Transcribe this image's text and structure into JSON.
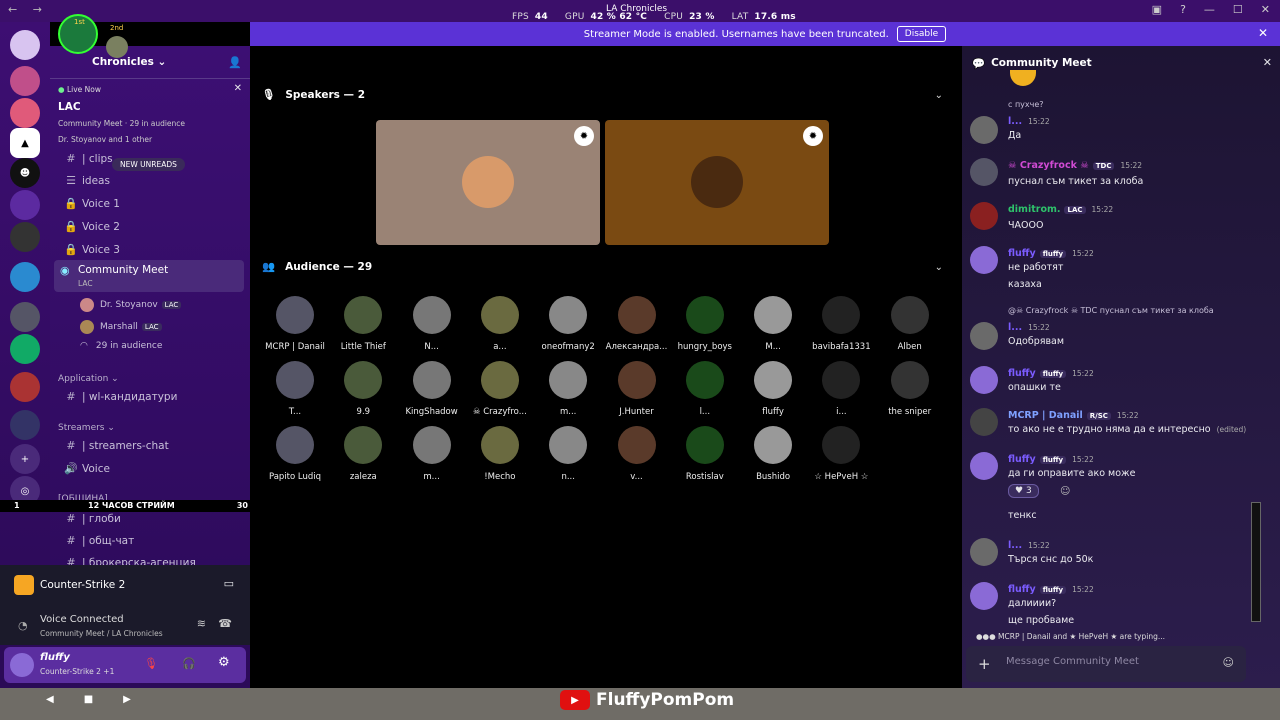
{
  "topbar": {
    "fps_label": "FPS",
    "fps": "44",
    "gpu_label": "GPU",
    "gpu": "42 % 62 °C",
    "cpu_label": "CPU",
    "cpu": "23 %",
    "lat_label": "LAT",
    "lat": "17.6 ms",
    "title": "LA Chronicles"
  },
  "banner": {
    "text": "Streamer Mode is enabled. Usernames have been truncated.",
    "button": "Disable"
  },
  "ranks": {
    "first": "1st",
    "second": "2nd"
  },
  "server": {
    "name": "Chronicles"
  },
  "live": {
    "status": "Live Now",
    "server": "LAC",
    "meta": "Community Meet",
    "audience": "29 in audience",
    "hosts": "Dr. Stoyanov and 1 other"
  },
  "new_unreads": "NEW UNREADS",
  "channels": [
    {
      "name": "| clips",
      "icon": "#"
    },
    {
      "name": "ideas",
      "icon": "📦"
    },
    {
      "name": "Voice 1",
      "icon": "🔊"
    },
    {
      "name": "Voice 2",
      "icon": "🔊"
    },
    {
      "name": "Voice 3",
      "icon": "🔊"
    }
  ],
  "stage_channel": {
    "name": "Community Meet",
    "sub": "LAC",
    "members": [
      {
        "name": "Dr. Stoyanov",
        "tag": "LAC"
      },
      {
        "name": "Marshall",
        "tag": "LAC"
      }
    ],
    "audience": "29 in audience"
  },
  "categories": {
    "application": "Application",
    "streamers": "Streamers",
    "community": "[ОБЩИНА]"
  },
  "app_channels": [
    {
      "name": "| wl-кандидатури"
    }
  ],
  "streamer_channels": [
    {
      "name": "| streamers-chat"
    },
    {
      "name": "Voice"
    }
  ],
  "community_channels": [
    {
      "name": "| глоби"
    },
    {
      "name": "| общ-чат"
    },
    {
      "name": "| брокерска-агенция"
    }
  ],
  "strip": {
    "left": "1",
    "center": "12 ЧАСОВ СТРИЙМ",
    "right": "30"
  },
  "activity": {
    "game": "Counter-Strike 2"
  },
  "voice": {
    "status": "Voice Connected",
    "channel": "Community Meet / LA Chronicles"
  },
  "user": {
    "name": "fluffy",
    "status": "Counter-Strike 2 +1"
  },
  "stage": {
    "speakers_label": "Speakers — 2",
    "audience_label": "Audience — 29"
  },
  "audience": [
    "MCRP | Danail",
    "Little Thief",
    "N...",
    "a...",
    "oneofmany2",
    "Александра...",
    "hungry_boys",
    "M...",
    "bavibafa1331",
    "Alben",
    "T...",
    "9.9",
    "KingShadow",
    "☠ Crazyfro...",
    "m...",
    "J.Hunter",
    "l...",
    "fluffy",
    "i...",
    "the sniper",
    "Papito Ludiq",
    "zaleza",
    "m...",
    "!Mecho",
    "n...",
    "v...",
    "Rostislav",
    "Bushido",
    "☆ HePvеН ☆"
  ],
  "chat": {
    "title": "Community Meet",
    "messages": [
      {
        "reply": "с пухче?",
        "name": "l...",
        "time": "15:22",
        "lines": [
          "Да"
        ]
      },
      {
        "name": "☠ Crazyfrock ☠",
        "tag": "TDC",
        "time": "15:22",
        "lines": [
          "пуснал съм тикет за клоба"
        ]
      },
      {
        "name": "dimitrom.",
        "tag": "LAC",
        "time": "15:22",
        "lines": [
          "ЧАООО"
        ]
      },
      {
        "name": "fluffy",
        "tag": "fluffy",
        "time": "15:22",
        "lines": [
          "не работят",
          "казаха"
        ]
      },
      {
        "reply": "@☠ Crazyfrock ☠  TDC  пуснал съм тикет за клоба",
        "name": "l...",
        "time": "15:22",
        "lines": [
          "Одобрявам"
        ]
      },
      {
        "name": "fluffy",
        "tag": "fluffy",
        "time": "15:22",
        "lines": [
          "опашки те"
        ]
      },
      {
        "name": "MCRP | Danail",
        "tag": "R/SC",
        "time": "15:22",
        "lines": [
          "то ако не е трудно няма да е интересно"
        ],
        "edited": "(edited)"
      },
      {
        "name": "fluffy",
        "tag": "fluffy",
        "time": "15:22",
        "lines": [
          "да ги оправите ако може"
        ],
        "reaction": "3",
        "extra": "тенкс"
      },
      {
        "name": "l...",
        "time": "15:22",
        "lines": [
          "Търся снс до 50к"
        ]
      },
      {
        "name": "fluffy",
        "tag": "fluffy",
        "time": "15:22",
        "lines": [
          "далииии?",
          "ще пробваме"
        ]
      }
    ],
    "typing": "MCRP | Danail and ★ HePvеН ★ are typing...",
    "placeholder": "Message Community Meet"
  },
  "bottom": {
    "channel": "FluffyPomPom"
  },
  "colors": {
    "accent": "#5b32d6",
    "sidebar": "#3c0f73",
    "fluffy": "#7b5cff",
    "crazy": "#d14bd4",
    "dimi": "#2ec26b"
  }
}
